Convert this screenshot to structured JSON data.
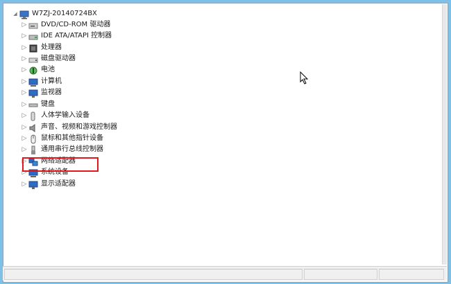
{
  "tree": {
    "root": {
      "label": "W7ZJ-20140724BX",
      "icon": "computer-icon",
      "expander": "◢"
    },
    "items": [
      {
        "label": "DVD/CD-ROM 驱动器",
        "icon": "dvd-drive-icon"
      },
      {
        "label": "IDE ATA/ATAPI 控制器",
        "icon": "ide-controller-icon"
      },
      {
        "label": "处理器",
        "icon": "processor-icon"
      },
      {
        "label": "磁盘驱动器",
        "icon": "disk-drive-icon"
      },
      {
        "label": "电池",
        "icon": "battery-icon"
      },
      {
        "label": "计算机",
        "icon": "computer-icon"
      },
      {
        "label": "监视器",
        "icon": "monitor-icon"
      },
      {
        "label": "键盘",
        "icon": "keyboard-icon"
      },
      {
        "label": "人体学输入设备",
        "icon": "hid-icon"
      },
      {
        "label": "声音、视频和游戏控制器",
        "icon": "sound-icon"
      },
      {
        "label": "鼠标和其他指针设备",
        "icon": "mouse-icon"
      },
      {
        "label": "通用串行总线控制器",
        "icon": "usb-icon"
      },
      {
        "label": "网络适配器",
        "icon": "network-adapter-icon"
      },
      {
        "label": "系统设备",
        "icon": "system-devices-icon"
      },
      {
        "label": "显示适配器",
        "icon": "display-adapter-icon"
      }
    ],
    "collapsed_expander": "▷"
  },
  "colors": {
    "highlight": "#e0171b",
    "background": "#7fc0e6"
  }
}
